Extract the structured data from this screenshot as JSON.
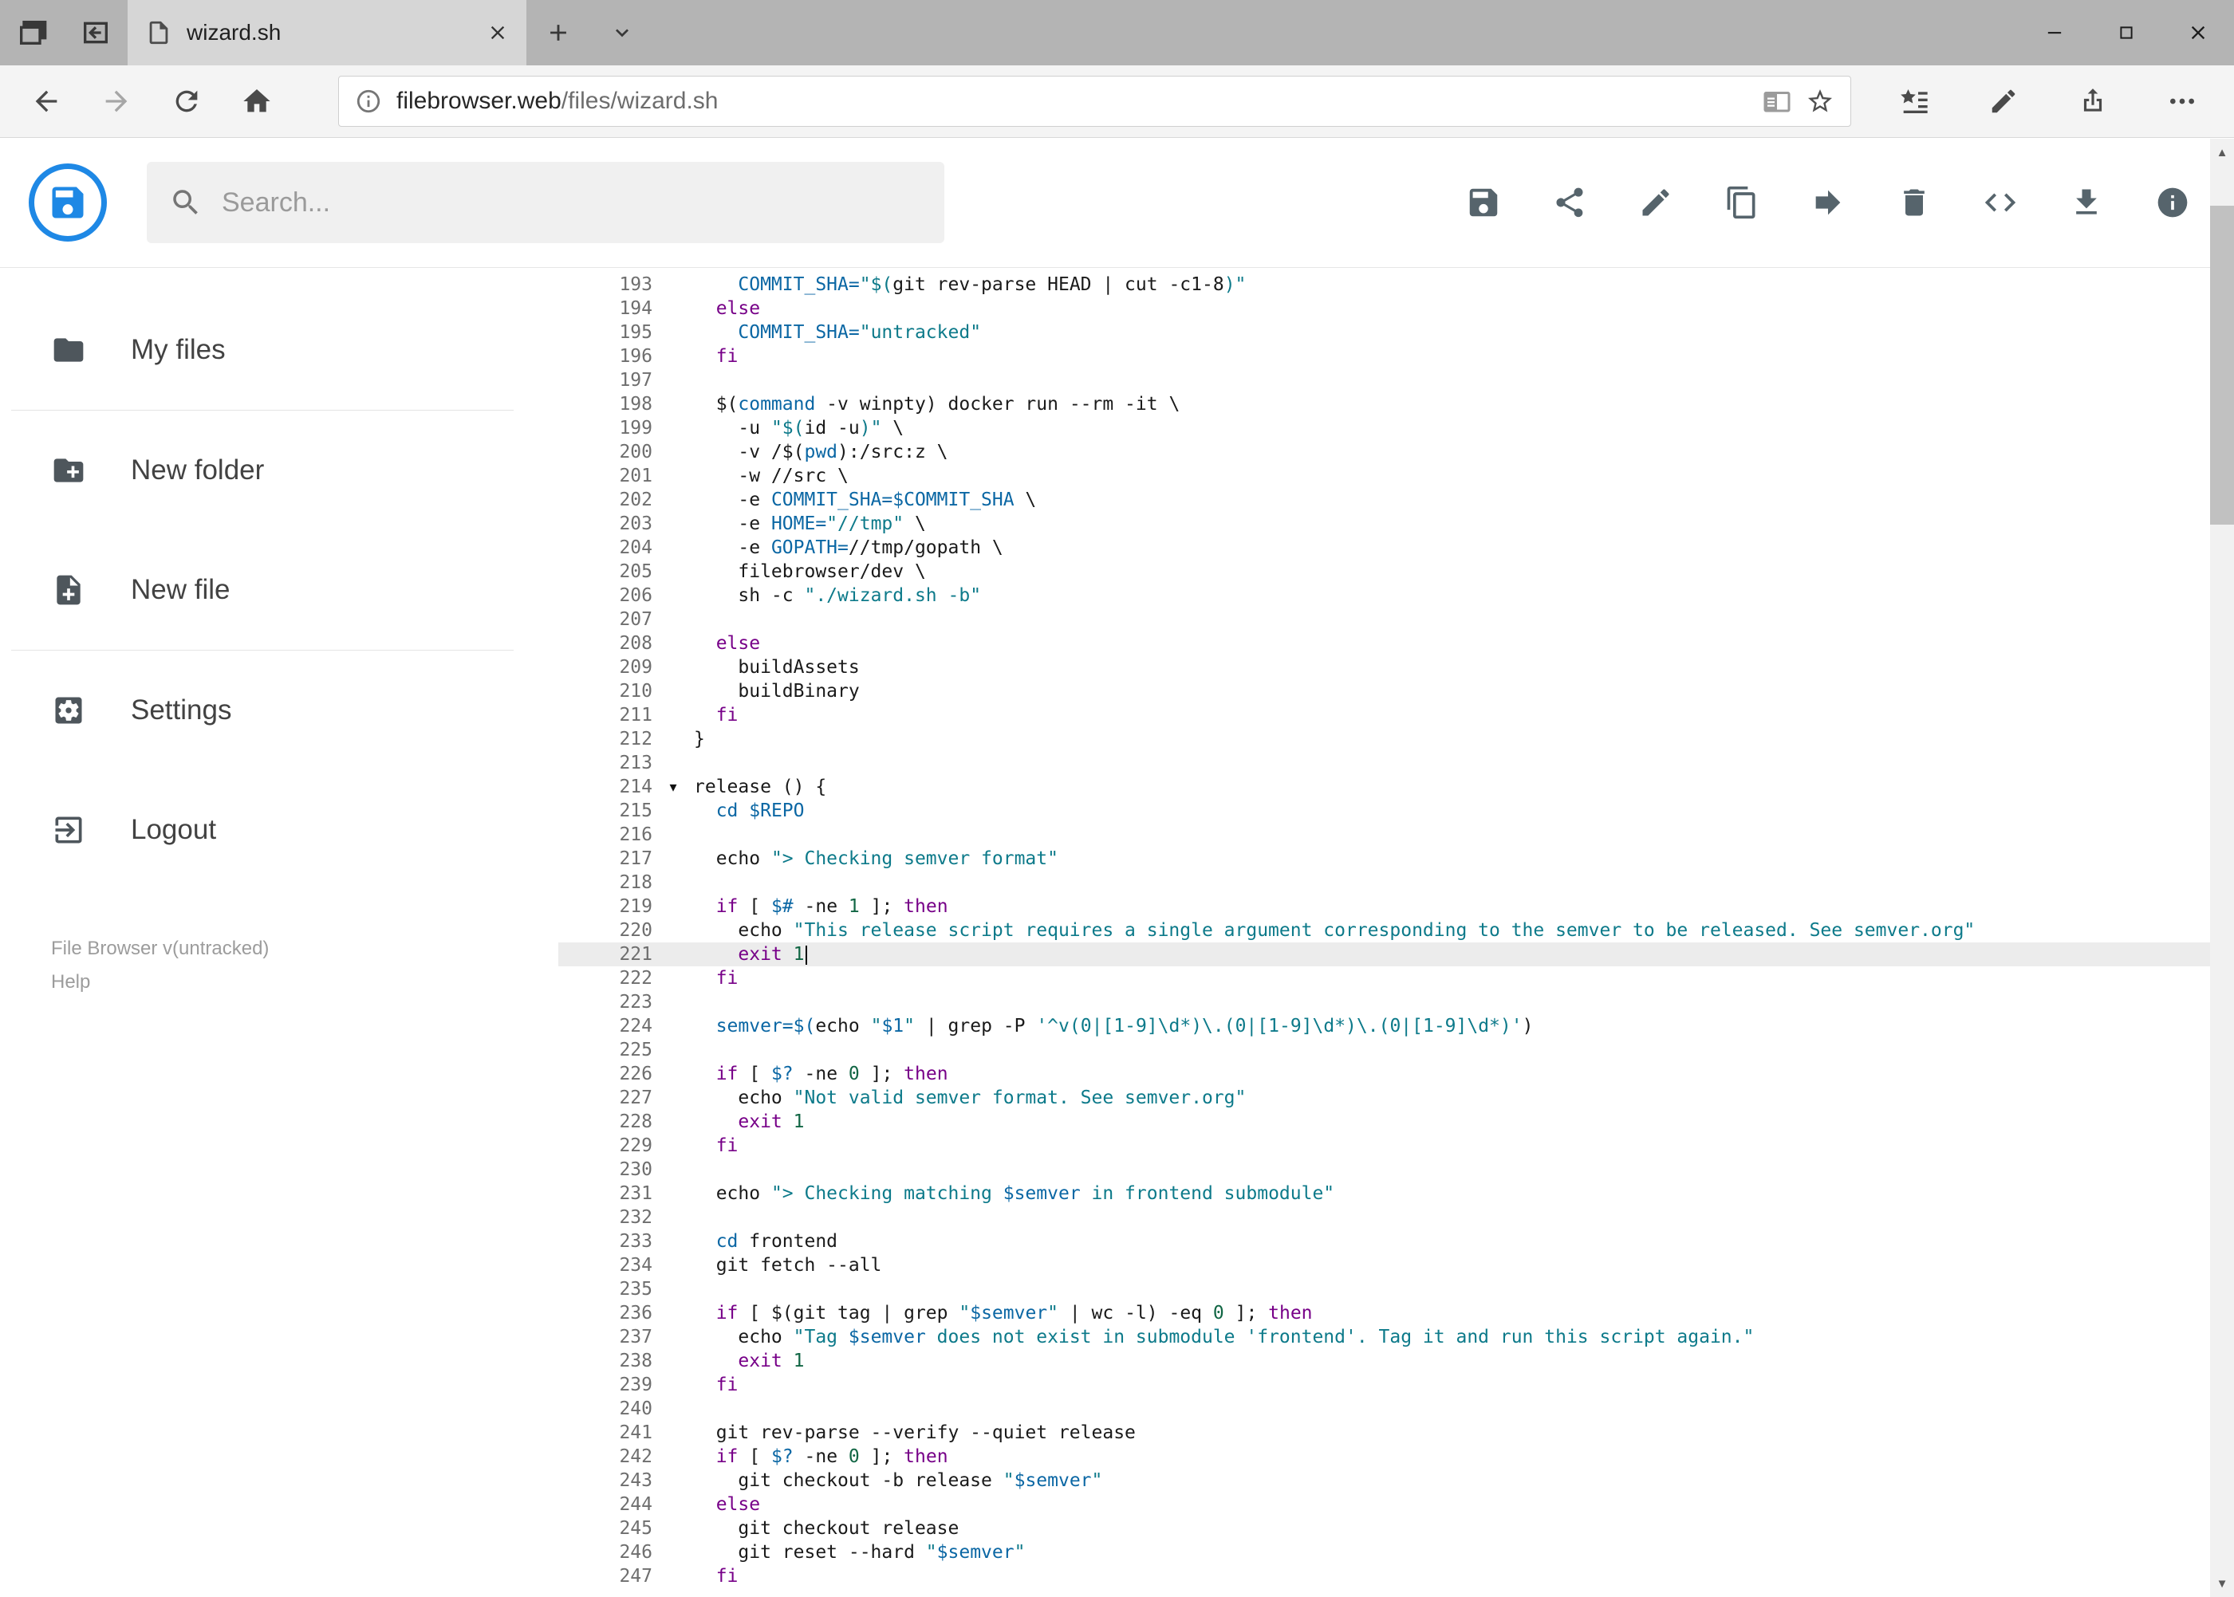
{
  "window": {
    "tab_title": "wizard.sh"
  },
  "nav": {
    "url_domain": "filebrowser.web",
    "url_path": "/files/wizard.sh"
  },
  "app": {
    "search_placeholder": "Search...",
    "accent_color": "#1e88e5",
    "toolbar_icons": [
      "save",
      "share",
      "edit",
      "copy",
      "move",
      "delete",
      "code",
      "download",
      "info"
    ],
    "sidebar": {
      "items": [
        {
          "icon": "folder",
          "label": "My files"
        },
        {
          "icon": "folder-plus",
          "label": "New folder"
        },
        {
          "icon": "file-plus",
          "label": "New file"
        },
        {
          "icon": "settings",
          "label": "Settings"
        },
        {
          "icon": "logout",
          "label": "Logout"
        }
      ],
      "version": "File Browser v(untracked)",
      "help": "Help"
    }
  },
  "editor": {
    "language": "shell",
    "active_line": 221,
    "fold_marker_line": 214,
    "fold_marker": "▾",
    "token_colors": {
      "p": "#1a1a1a",
      "k": "#770088",
      "s": "#0d7a8a",
      "v": "#0b67a4",
      "b": "#0b67a4",
      "n": "#116644"
    },
    "lines": [
      {
        "n": 193,
        "t": [
          [
            "p",
            "    "
          ],
          [
            "v",
            "COMMIT_SHA="
          ],
          [
            "s",
            "\"$("
          ],
          [
            "p",
            "git rev-parse HEAD | cut -c1-8"
          ],
          [
            "s",
            ")\""
          ]
        ]
      },
      {
        "n": 194,
        "t": [
          [
            "p",
            "  "
          ],
          [
            "k",
            "else"
          ]
        ]
      },
      {
        "n": 195,
        "t": [
          [
            "p",
            "    "
          ],
          [
            "v",
            "COMMIT_SHA="
          ],
          [
            "s",
            "\"untracked\""
          ]
        ]
      },
      {
        "n": 196,
        "t": [
          [
            "p",
            "  "
          ],
          [
            "k",
            "fi"
          ]
        ]
      },
      {
        "n": 197,
        "t": []
      },
      {
        "n": 198,
        "t": [
          [
            "p",
            "  $("
          ],
          [
            "b",
            "command"
          ],
          [
            "p",
            " -v winpty) docker run --rm -it \\"
          ]
        ]
      },
      {
        "n": 199,
        "t": [
          [
            "p",
            "    -u "
          ],
          [
            "s",
            "\"$("
          ],
          [
            "p",
            "id -u"
          ],
          [
            "s",
            ")\""
          ],
          [
            "p",
            " \\"
          ]
        ]
      },
      {
        "n": 200,
        "t": [
          [
            "p",
            "    -v /$("
          ],
          [
            "b",
            "pwd"
          ],
          [
            "p",
            "):/src:z \\"
          ]
        ]
      },
      {
        "n": 201,
        "t": [
          [
            "p",
            "    -w //src \\"
          ]
        ]
      },
      {
        "n": 202,
        "t": [
          [
            "p",
            "    -e "
          ],
          [
            "v",
            "COMMIT_SHA=$COMMIT_SHA"
          ],
          [
            "p",
            " \\"
          ]
        ]
      },
      {
        "n": 203,
        "t": [
          [
            "p",
            "    -e "
          ],
          [
            "v",
            "HOME="
          ],
          [
            "s",
            "\"//tmp\""
          ],
          [
            "p",
            " \\"
          ]
        ]
      },
      {
        "n": 204,
        "t": [
          [
            "p",
            "    -e "
          ],
          [
            "v",
            "GOPATH="
          ],
          [
            "p",
            "//tmp/gopath \\"
          ]
        ]
      },
      {
        "n": 205,
        "t": [
          [
            "p",
            "    filebrowser/dev \\"
          ]
        ]
      },
      {
        "n": 206,
        "t": [
          [
            "p",
            "    sh -c "
          ],
          [
            "s",
            "\"./wizard.sh -b\""
          ]
        ]
      },
      {
        "n": 207,
        "t": []
      },
      {
        "n": 208,
        "t": [
          [
            "p",
            "  "
          ],
          [
            "k",
            "else"
          ]
        ]
      },
      {
        "n": 209,
        "t": [
          [
            "p",
            "    buildAssets"
          ]
        ]
      },
      {
        "n": 210,
        "t": [
          [
            "p",
            "    buildBinary"
          ]
        ]
      },
      {
        "n": 211,
        "t": [
          [
            "p",
            "  "
          ],
          [
            "k",
            "fi"
          ]
        ]
      },
      {
        "n": 212,
        "t": [
          [
            "p",
            "}"
          ]
        ]
      },
      {
        "n": 213,
        "t": []
      },
      {
        "n": 214,
        "t": [
          [
            "p",
            "release () {"
          ]
        ]
      },
      {
        "n": 215,
        "t": [
          [
            "p",
            "  "
          ],
          [
            "b",
            "cd"
          ],
          [
            "p",
            " "
          ],
          [
            "v",
            "$REPO"
          ]
        ]
      },
      {
        "n": 216,
        "t": []
      },
      {
        "n": 217,
        "t": [
          [
            "p",
            "  echo "
          ],
          [
            "s",
            "\"> Checking semver format\""
          ]
        ]
      },
      {
        "n": 218,
        "t": []
      },
      {
        "n": 219,
        "t": [
          [
            "p",
            "  "
          ],
          [
            "k",
            "if"
          ],
          [
            "p",
            " [ "
          ],
          [
            "v",
            "$#"
          ],
          [
            "p",
            " -ne "
          ],
          [
            "n",
            "1"
          ],
          [
            "p",
            " ]; "
          ],
          [
            "k",
            "then"
          ]
        ]
      },
      {
        "n": 220,
        "t": [
          [
            "p",
            "    echo "
          ],
          [
            "s",
            "\"This release script requires a single argument corresponding to the semver to be released. See semver.org\""
          ]
        ]
      },
      {
        "n": 221,
        "t": [
          [
            "p",
            "    "
          ],
          [
            "k",
            "exit"
          ],
          [
            "p",
            " "
          ],
          [
            "n",
            "1"
          ]
        ]
      },
      {
        "n": 222,
        "t": [
          [
            "p",
            "  "
          ],
          [
            "k",
            "fi"
          ]
        ]
      },
      {
        "n": 223,
        "t": []
      },
      {
        "n": 224,
        "t": [
          [
            "p",
            "  "
          ],
          [
            "v",
            "semver=$("
          ],
          [
            "p",
            "echo "
          ],
          [
            "s",
            "\""
          ],
          [
            "v",
            "$1"
          ],
          [
            "s",
            "\""
          ],
          [
            "p",
            " | grep -P "
          ],
          [
            "s",
            "'^v(0|[1-9]\\d*)\\.(0|[1-9]\\d*)\\.(0|[1-9]\\d*)'"
          ],
          [
            "p",
            ")"
          ]
        ]
      },
      {
        "n": 225,
        "t": []
      },
      {
        "n": 226,
        "t": [
          [
            "p",
            "  "
          ],
          [
            "k",
            "if"
          ],
          [
            "p",
            " [ "
          ],
          [
            "v",
            "$?"
          ],
          [
            "p",
            " -ne "
          ],
          [
            "n",
            "0"
          ],
          [
            "p",
            " ]; "
          ],
          [
            "k",
            "then"
          ]
        ]
      },
      {
        "n": 227,
        "t": [
          [
            "p",
            "    echo "
          ],
          [
            "s",
            "\"Not valid semver format. See semver.org\""
          ]
        ]
      },
      {
        "n": 228,
        "t": [
          [
            "p",
            "    "
          ],
          [
            "k",
            "exit"
          ],
          [
            "p",
            " "
          ],
          [
            "n",
            "1"
          ]
        ]
      },
      {
        "n": 229,
        "t": [
          [
            "p",
            "  "
          ],
          [
            "k",
            "fi"
          ]
        ]
      },
      {
        "n": 230,
        "t": []
      },
      {
        "n": 231,
        "t": [
          [
            "p",
            "  echo "
          ],
          [
            "s",
            "\"> Checking matching "
          ],
          [
            "v",
            "$semver"
          ],
          [
            "s",
            " in frontend submodule\""
          ]
        ]
      },
      {
        "n": 232,
        "t": []
      },
      {
        "n": 233,
        "t": [
          [
            "p",
            "  "
          ],
          [
            "b",
            "cd"
          ],
          [
            "p",
            " frontend"
          ]
        ]
      },
      {
        "n": 234,
        "t": [
          [
            "p",
            "  git fetch --all"
          ]
        ]
      },
      {
        "n": 235,
        "t": []
      },
      {
        "n": 236,
        "t": [
          [
            "p",
            "  "
          ],
          [
            "k",
            "if"
          ],
          [
            "p",
            " [ $(git tag | grep "
          ],
          [
            "s",
            "\""
          ],
          [
            "v",
            "$semver"
          ],
          [
            "s",
            "\""
          ],
          [
            "p",
            " | wc -l) -eq "
          ],
          [
            "n",
            "0"
          ],
          [
            "p",
            " ]; "
          ],
          [
            "k",
            "then"
          ]
        ]
      },
      {
        "n": 237,
        "t": [
          [
            "p",
            "    echo "
          ],
          [
            "s",
            "\"Tag "
          ],
          [
            "v",
            "$semver"
          ],
          [
            "s",
            " does not exist in submodule 'frontend'. Tag it and run this script again.\""
          ]
        ]
      },
      {
        "n": 238,
        "t": [
          [
            "p",
            "    "
          ],
          [
            "k",
            "exit"
          ],
          [
            "p",
            " "
          ],
          [
            "n",
            "1"
          ]
        ]
      },
      {
        "n": 239,
        "t": [
          [
            "p",
            "  "
          ],
          [
            "k",
            "fi"
          ]
        ]
      },
      {
        "n": 240,
        "t": []
      },
      {
        "n": 241,
        "t": [
          [
            "p",
            "  git rev-parse --verify --quiet release"
          ]
        ]
      },
      {
        "n": 242,
        "t": [
          [
            "p",
            "  "
          ],
          [
            "k",
            "if"
          ],
          [
            "p",
            " [ "
          ],
          [
            "v",
            "$?"
          ],
          [
            "p",
            " -ne "
          ],
          [
            "n",
            "0"
          ],
          [
            "p",
            " ]; "
          ],
          [
            "k",
            "then"
          ]
        ]
      },
      {
        "n": 243,
        "t": [
          [
            "p",
            "    git checkout -b release "
          ],
          [
            "s",
            "\""
          ],
          [
            "v",
            "$semver"
          ],
          [
            "s",
            "\""
          ]
        ]
      },
      {
        "n": 244,
        "t": [
          [
            "p",
            "  "
          ],
          [
            "k",
            "else"
          ]
        ]
      },
      {
        "n": 245,
        "t": [
          [
            "p",
            "    git checkout release"
          ]
        ]
      },
      {
        "n": 246,
        "t": [
          [
            "p",
            "    git reset --hard "
          ],
          [
            "s",
            "\""
          ],
          [
            "v",
            "$semver"
          ],
          [
            "s",
            "\""
          ]
        ]
      },
      {
        "n": 247,
        "t": [
          [
            "p",
            "  "
          ],
          [
            "k",
            "fi"
          ]
        ]
      }
    ]
  }
}
